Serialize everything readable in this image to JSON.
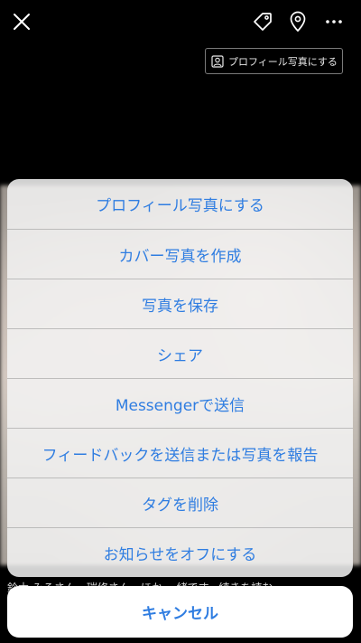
{
  "topbar": {
    "close_icon": "close-icon",
    "tag_icon": "tag-icon",
    "location_icon": "location-pin-icon",
    "more_icon": "more-icon",
    "profile_chip_label": "プロフィール写真にする"
  },
  "photo": {
    "caption": "鈴木 みるさん、瑞修さん、ほか 一緒です。続きを読む"
  },
  "action_sheet": {
    "items": [
      {
        "label": "プロフィール写真にする"
      },
      {
        "label": "カバー写真を作成"
      },
      {
        "label": "写真を保存"
      },
      {
        "label": "シェア"
      },
      {
        "label": "Messengerで送信"
      },
      {
        "label": "フィードバックを送信または写真を報告"
      },
      {
        "label": "タグを削除"
      },
      {
        "label": "お知らせをオフにする"
      }
    ],
    "cancel_label": "キャンセル"
  },
  "colors": {
    "accent": "#2f7de1",
    "background": "#000000",
    "sheet_bg": "#f3f3f3"
  }
}
